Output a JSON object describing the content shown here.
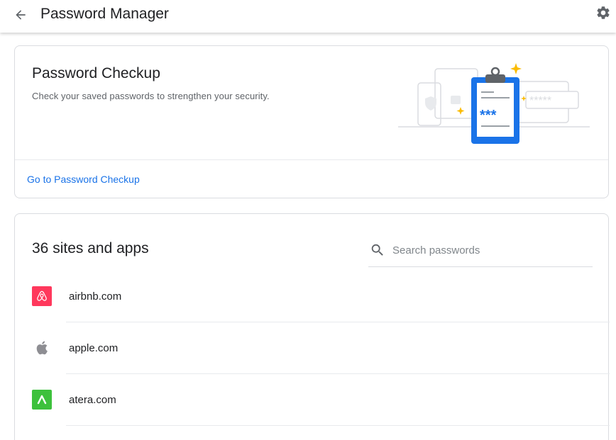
{
  "header": {
    "title": "Password Manager",
    "back_icon": "arrow-back-icon",
    "settings_icon": "gear-icon"
  },
  "checkup": {
    "title": "Password Checkup",
    "description": "Check your saved passwords to strengthen your security.",
    "link": "Go to Password Checkup",
    "illustration_text": "***"
  },
  "list": {
    "title": "36 sites and apps",
    "search_placeholder": "Search passwords",
    "sites": [
      {
        "name": "airbnb.com",
        "icon": "airbnb-icon",
        "color": "#ff385c"
      },
      {
        "name": "apple.com",
        "icon": "apple-icon",
        "color": "#8e8e93"
      },
      {
        "name": "atera.com",
        "icon": "atera-icon",
        "color": "#3dc13c"
      }
    ]
  },
  "colors": {
    "link": "#1a73e8",
    "clipboard": "#1a73e8",
    "star": "#fbbc04"
  }
}
